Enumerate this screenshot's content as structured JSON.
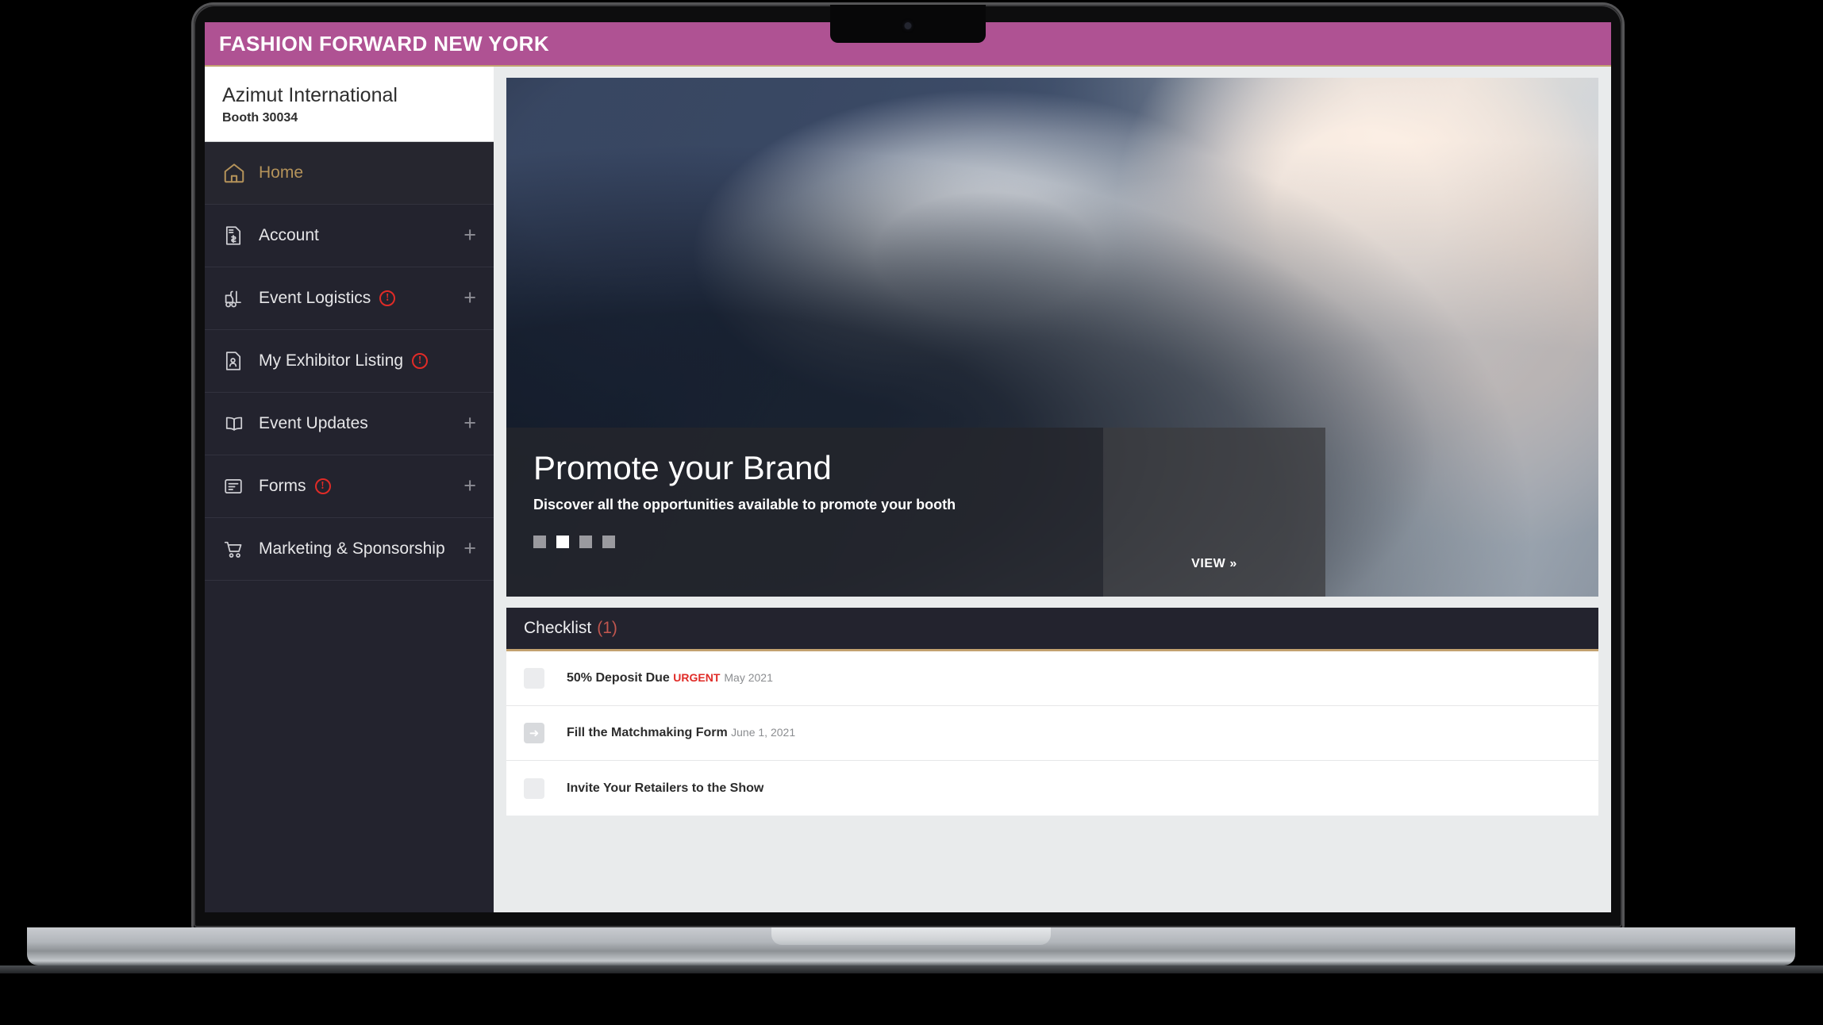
{
  "app": {
    "title": "FASHION FORWARD NEW YORK",
    "brand_color": "#af5293",
    "sidebar_color": "#23232e",
    "accent_gold": "#c3a270",
    "alert_color": "#e02b27"
  },
  "exhibitor": {
    "name": "Azimut International",
    "booth": "Booth 30034"
  },
  "sidebar": {
    "items": [
      {
        "label": "Home",
        "icon": "home-icon",
        "active": true,
        "alert": false,
        "expander": ""
      },
      {
        "label": "Account",
        "icon": "invoice-icon",
        "active": false,
        "alert": false,
        "expander": "+"
      },
      {
        "label": "Event Logistics",
        "icon": "forklift-icon",
        "active": false,
        "alert": true,
        "expander": "+"
      },
      {
        "label": "My Exhibitor Listing",
        "icon": "listing-card-icon",
        "active": false,
        "alert": true,
        "expander": ""
      },
      {
        "label": "Event Updates",
        "icon": "open-book-icon",
        "active": false,
        "alert": false,
        "expander": "+"
      },
      {
        "label": "Forms",
        "icon": "form-document-icon",
        "active": false,
        "alert": true,
        "expander": "+"
      },
      {
        "label": "Marketing & Sponsorship",
        "icon": "shopping-cart-icon",
        "active": false,
        "alert": false,
        "expander": "+"
      }
    ],
    "alert_symbol": "!"
  },
  "hero": {
    "title": "Promote your Brand",
    "subtitle": "Discover all the opportunities available to promote your booth",
    "view_label": "VIEW »",
    "slides": 4,
    "active_slide": 2
  },
  "checklist": {
    "title": "Checklist",
    "count": "(1)",
    "rows": [
      {
        "label": "50% Deposit Due",
        "urgent": "URGENT",
        "date": "May 2021",
        "arrow": false
      },
      {
        "label": "Fill the Matchmaking Form",
        "urgent": "",
        "date": "June 1, 2021",
        "arrow": true
      },
      {
        "label": "Invite Your Retailers to the Show",
        "urgent": "",
        "date": "",
        "arrow": false
      }
    ],
    "arrow_glyph": "➜"
  }
}
